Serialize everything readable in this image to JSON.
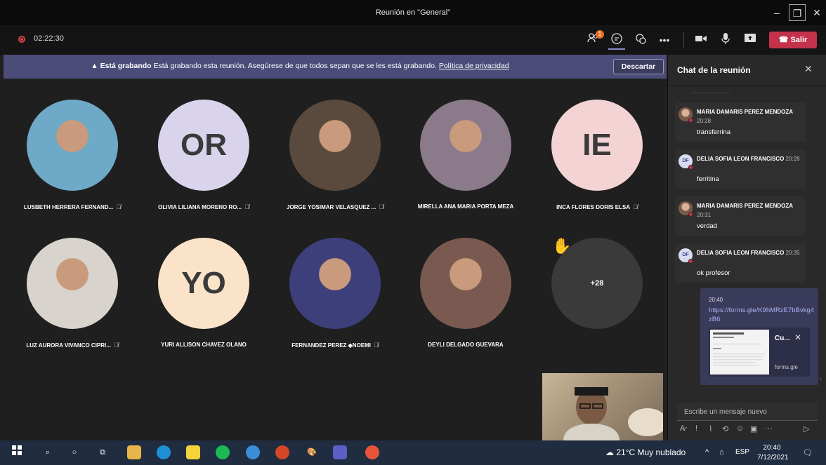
{
  "window": {
    "title": "Reunión en \"General\"",
    "minimize": "–",
    "restore": "❐",
    "close": "✕"
  },
  "toolbar": {
    "timer": "02:22:30",
    "participants_badge": "1",
    "more": "•••",
    "leave_label": "Salir"
  },
  "banner": {
    "bold": "Está grabando",
    "text": "Está grabando esta reunión. Asegúrese de que todos sepan que se les está grabando.",
    "link": "Política de privacidad",
    "dismiss": "Descartar"
  },
  "participants": [
    {
      "name": "LUSBETH HERRERA FERNAND...",
      "initials": "",
      "muted": true,
      "photo_color": "#6ea9c8"
    },
    {
      "name": "OLIVIA LILIANA MORENO RO...",
      "initials": "OR",
      "muted": true,
      "bg": "#d9d4ec"
    },
    {
      "name": "JORGE YOSIMAR VELASQUEZ ...",
      "initials": "",
      "muted": true,
      "photo_color": "#5a4a3e"
    },
    {
      "name": "MIRELLA ANA MARIA PORTA MEZA",
      "initials": "",
      "muted": false,
      "photo_color": "#8a7a8a"
    },
    {
      "name": "INCA FLORES DORIS ELSA",
      "initials": "IE",
      "muted": true,
      "bg": "#f3d3d3"
    },
    {
      "name": "LUZ AURORA VIVANCO CIPRI...",
      "initials": "",
      "muted": true,
      "photo_color": "#d8d3cc"
    },
    {
      "name": "YURI ALLISON CHAVEZ OLANO",
      "initials": "YO",
      "muted": false,
      "bg": "#fbe3c9"
    },
    {
      "name": "FERNANDEZ PEREZ ◆NOEMI",
      "initials": "",
      "muted": true,
      "photo_color": "#3d3f7a"
    },
    {
      "name": "DEYLI DELGADO GUEVARA",
      "initials": "",
      "muted": false,
      "photo_color": "#7a5a50"
    }
  ],
  "overflow": {
    "count": "+28"
  },
  "chat": {
    "title": "Chat de la reunión",
    "messages": [
      {
        "sender": "MARIA DAMARIS PEREZ MENDOZA",
        "time": "20:28",
        "text": "transferrina",
        "avatar": ""
      },
      {
        "sender": "DELIA SOFIA LEON FRANCISCO",
        "time": "20:28",
        "text": "ferritina",
        "avatar": "DF"
      },
      {
        "sender": "MARIA DAMARIS PEREZ MENDOZA",
        "time": "20:31",
        "text": "verdad",
        "avatar": ""
      },
      {
        "sender": "DELIA SOFIA LEON FRANCISCO",
        "time": "20:35",
        "text": "ok profesor",
        "avatar": "DF"
      }
    ],
    "mine": {
      "time": "20:40",
      "link": "https://forms.gle/K9hMRzE7bBvkg4zB6",
      "card_title": "Cu...",
      "card_close": "✕",
      "card_domain": "forms.gle"
    },
    "compose_placeholder": "Escribe un mensaje nuevo"
  },
  "taskbar": {
    "weather": "21°C  Muy nublado",
    "lang": "ESP",
    "time": "20:40",
    "date": "7/12/2021"
  }
}
